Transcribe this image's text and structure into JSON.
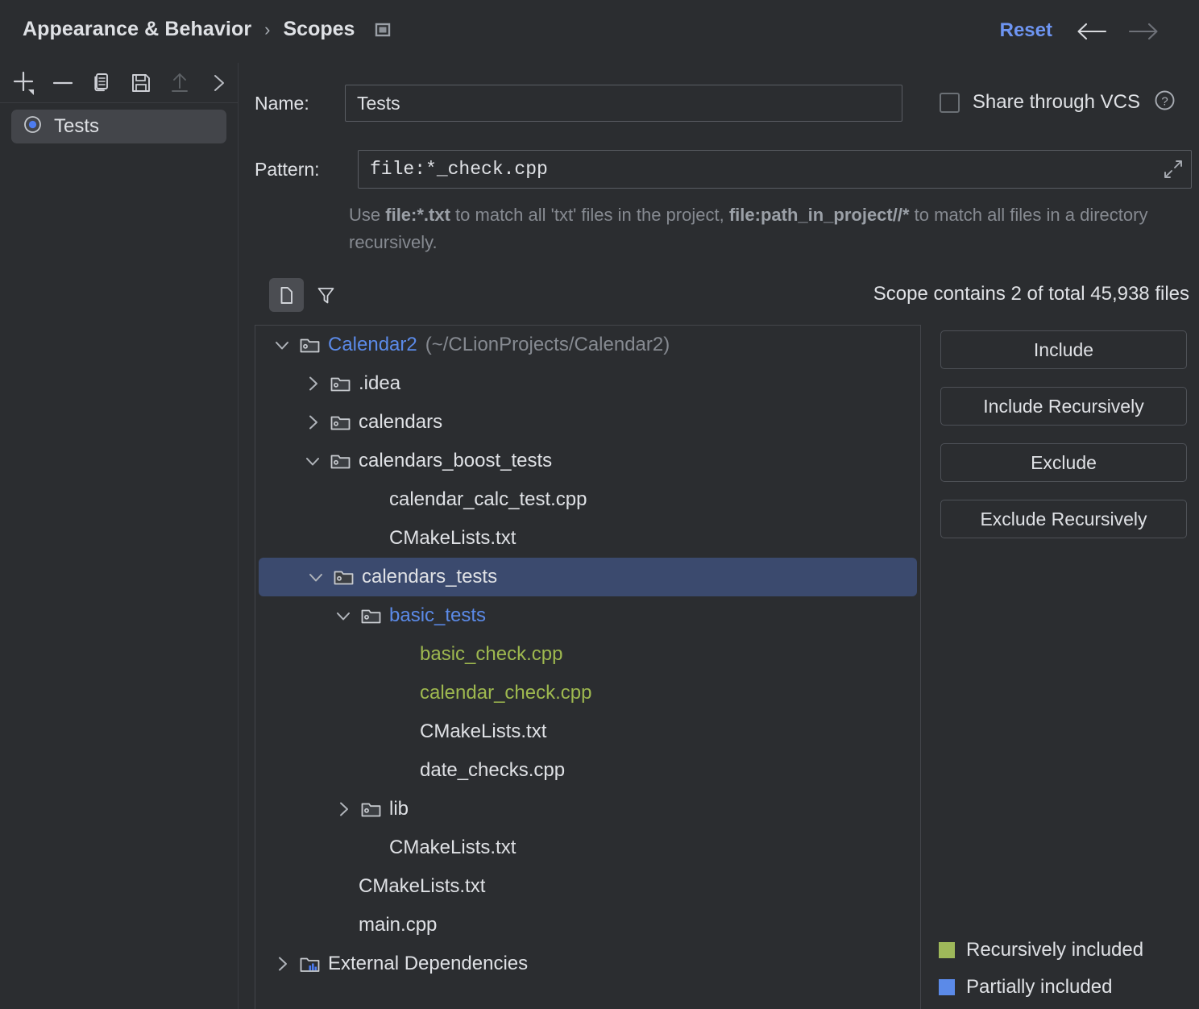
{
  "header": {
    "breadcrumb_root": "Appearance & Behavior",
    "breadcrumb_separator": "›",
    "breadcrumb_current": "Scopes",
    "panel_toggle_icon": "panel-square-icon",
    "reset_label": "Reset",
    "back_icon": "arrow-left-icon",
    "forward_icon": "arrow-right-icon"
  },
  "sidebar": {
    "toolbar": [
      {
        "name": "add-scope-button",
        "icon": "plus-dropdown-icon",
        "enabled": true
      },
      {
        "name": "remove-scope-button",
        "icon": "minus-icon",
        "enabled": true
      },
      {
        "name": "duplicate-scope-button",
        "icon": "copy-icon",
        "enabled": true
      },
      {
        "name": "save-scope-button",
        "icon": "save-floppy-icon",
        "enabled": true
      },
      {
        "name": "share-scope-button",
        "icon": "upload-arrow-icon",
        "enabled": false
      },
      {
        "name": "expand-toolbar-button",
        "icon": "chevron-right-icon",
        "enabled": true
      }
    ],
    "items": [
      {
        "label": "Tests",
        "icon": "scope-circle-icon",
        "selected": true
      }
    ]
  },
  "form": {
    "name_label": "Name:",
    "name_value": "Tests",
    "share_vcs_label": "Share through VCS",
    "share_vcs_checked": false,
    "help_icon": "question-circle-icon",
    "pattern_label": "Pattern:",
    "pattern_value": "file:*_check.cpp",
    "pattern_expand_icon": "expand-diagonal-icon",
    "hint_parts": [
      {
        "text": "Use ",
        "bold": false
      },
      {
        "text": "file:*.txt",
        "bold": true
      },
      {
        "text": " to match all 'txt' files in the project, ",
        "bold": false
      },
      {
        "text": "file:path_in_project//*",
        "bold": true
      },
      {
        "text": " to match all files in a directory recursively.",
        "bold": false
      }
    ]
  },
  "tree_toolbar": {
    "buttons": [
      {
        "name": "flatten-packages-toggle",
        "icon": "file-outline-icon",
        "active": true
      },
      {
        "name": "filter-button",
        "icon": "filter-funnel-icon",
        "active": false
      }
    ],
    "scope_count_text": "Scope contains 2 of total 45,938 files"
  },
  "tree": {
    "rows": [
      {
        "indent": 0,
        "twisty": "down",
        "icon": "module-folder-icon",
        "label": "Calendar2",
        "color": "blue",
        "path": "(~/CLionProjects/Calendar2)",
        "selected": false
      },
      {
        "indent": 1,
        "twisty": "right",
        "icon": "module-folder-icon",
        "label": ".idea",
        "color": "default",
        "path": "",
        "selected": false
      },
      {
        "indent": 1,
        "twisty": "right",
        "icon": "module-folder-icon",
        "label": "calendars",
        "color": "default",
        "path": "",
        "selected": false
      },
      {
        "indent": 1,
        "twisty": "down",
        "icon": "module-folder-icon",
        "label": "calendars_boost_tests",
        "color": "default",
        "path": "",
        "selected": false
      },
      {
        "indent": 2,
        "twisty": "none",
        "icon": "none",
        "label": "calendar_calc_test.cpp",
        "color": "default",
        "path": "",
        "selected": false
      },
      {
        "indent": 2,
        "twisty": "none",
        "icon": "none",
        "label": "CMakeLists.txt",
        "color": "default",
        "path": "",
        "selected": false
      },
      {
        "indent": 1,
        "twisty": "down",
        "icon": "module-folder-icon",
        "label": "calendars_tests",
        "color": "default",
        "path": "",
        "selected": true
      },
      {
        "indent": 2,
        "twisty": "down",
        "icon": "module-folder-icon",
        "label": "basic_tests",
        "color": "blue",
        "path": "",
        "selected": false
      },
      {
        "indent": 3,
        "twisty": "none",
        "icon": "none",
        "label": "basic_check.cpp",
        "color": "green",
        "path": "",
        "selected": false
      },
      {
        "indent": 3,
        "twisty": "none",
        "icon": "none",
        "label": "calendar_check.cpp",
        "color": "green",
        "path": "",
        "selected": false
      },
      {
        "indent": 3,
        "twisty": "none",
        "icon": "none",
        "label": "CMakeLists.txt",
        "color": "default",
        "path": "",
        "selected": false
      },
      {
        "indent": 3,
        "twisty": "none",
        "icon": "none",
        "label": "date_checks.cpp",
        "color": "default",
        "path": "",
        "selected": false
      },
      {
        "indent": 2,
        "twisty": "right",
        "icon": "module-folder-icon",
        "label": "lib",
        "color": "default",
        "path": "",
        "selected": false
      },
      {
        "indent": 2,
        "twisty": "none",
        "icon": "none",
        "label": "CMakeLists.txt",
        "color": "default",
        "path": "",
        "selected": false
      },
      {
        "indent": 1,
        "twisty": "none",
        "icon": "none",
        "label": "CMakeLists.txt",
        "color": "default",
        "path": "",
        "selected": false
      },
      {
        "indent": 1,
        "twisty": "none",
        "icon": "none",
        "label": "main.cpp",
        "color": "default",
        "path": "",
        "selected": false
      },
      {
        "indent": 0,
        "twisty": "right",
        "icon": "library-folder-icon",
        "label": "External Dependencies",
        "color": "default",
        "path": "",
        "selected": false
      }
    ]
  },
  "actions": {
    "buttons": [
      {
        "name": "include-button",
        "label": "Include"
      },
      {
        "name": "include-recursively-button",
        "label": "Include Recursively"
      },
      {
        "name": "exclude-button",
        "label": "Exclude"
      },
      {
        "name": "exclude-recursively-button",
        "label": "Exclude Recursively"
      }
    ]
  },
  "legend": {
    "items": [
      {
        "label": "Recursively included",
        "color": "#9eb85a"
      },
      {
        "label": "Partially included",
        "color": "#5b8ae8"
      }
    ]
  },
  "colors": {
    "background": "#2b2d30",
    "accent_blue": "#6e95f2",
    "selection": "#3b4a6e",
    "included_green": "#9eb84f",
    "partial_blue": "#5b8ae8"
  }
}
